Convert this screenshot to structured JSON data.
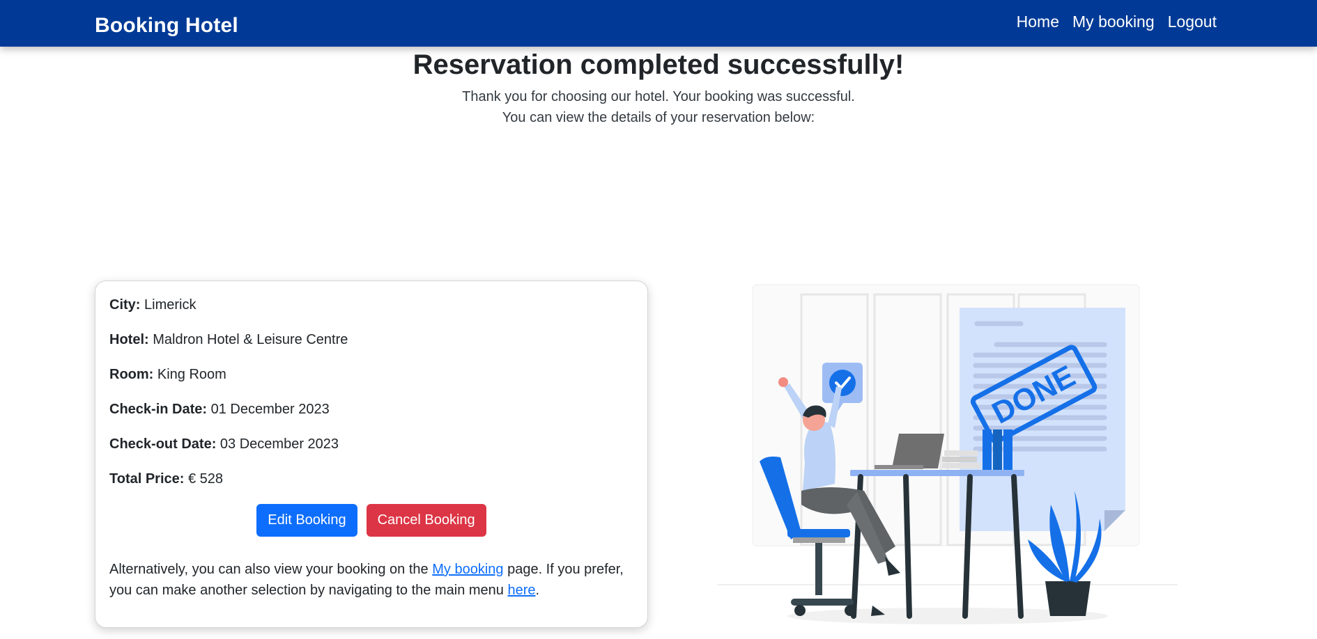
{
  "nav": {
    "brand": "Booking Hotel",
    "links": [
      "Home",
      "My booking",
      "Logout"
    ]
  },
  "hero": {
    "title": "Reservation completed successfully!",
    "line1": "Thank you for choosing our hotel. Your booking was successful.",
    "line2": "You can view the details of your reservation below:"
  },
  "details": {
    "city_label": "City:",
    "city": "Limerick",
    "hotel_label": "Hotel:",
    "hotel": "Maldron Hotel & Leisure Centre",
    "room_label": "Room:",
    "room": "King Room",
    "checkin_label": "Check-in Date:",
    "checkin": "01 December 2023",
    "checkout_label": "Check-out Date:",
    "checkout": "03 December 2023",
    "price_label": "Total Price:",
    "price": "€ 528"
  },
  "actions": {
    "edit": "Edit Booking",
    "cancel": "Cancel Booking"
  },
  "note": {
    "part1": "Alternatively, you can also view your booking on the",
    "link1": "My booking",
    "part2": "page. If you prefer, you can make another selection by navigating to the main menu",
    "link2": "here",
    "part3": "."
  },
  "illustration": {
    "stamp_text": "DONE"
  },
  "colors": {
    "navbar": "#003a96",
    "primary": "#0d6efd",
    "danger": "#dc3545"
  }
}
